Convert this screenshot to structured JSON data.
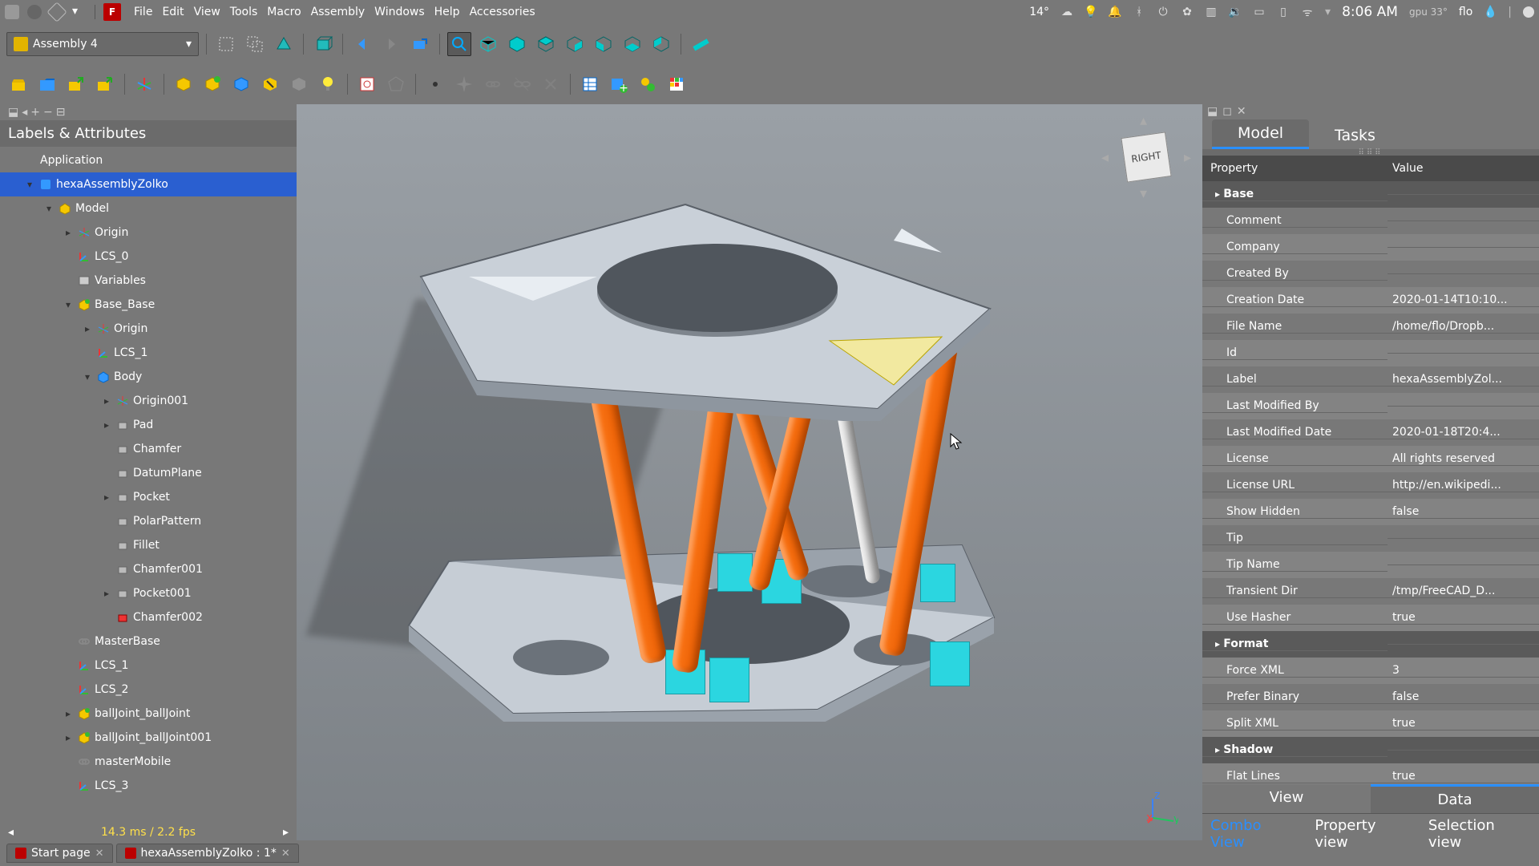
{
  "menubar": {
    "items": [
      "File",
      "Edit",
      "View",
      "Tools",
      "Macro",
      "Assembly",
      "Windows",
      "Help",
      "Accessories"
    ],
    "status": {
      "temp": "14°",
      "time": "8:06 AM",
      "gpu": "gpu 33°",
      "user": "flo"
    }
  },
  "workbench": {
    "selected": "Assembly 4"
  },
  "left_panel": {
    "title": "Labels & Attributes",
    "root": "Application"
  },
  "tree": [
    {
      "d": 0,
      "exp": "",
      "ico": "app",
      "label": "Application",
      "sel": false
    },
    {
      "d": 1,
      "exp": "▾",
      "ico": "doc",
      "label": "hexaAssemblyZolko",
      "sel": true
    },
    {
      "d": 2,
      "exp": "▾",
      "ico": "model",
      "label": "Model",
      "sel": false
    },
    {
      "d": 3,
      "exp": "▸",
      "ico": "origin",
      "label": "Origin",
      "sel": false
    },
    {
      "d": 3,
      "exp": "",
      "ico": "lcs",
      "label": "LCS_0",
      "sel": false
    },
    {
      "d": 3,
      "exp": "",
      "ico": "vars",
      "label": "Variables",
      "sel": false
    },
    {
      "d": 3,
      "exp": "▾",
      "ico": "body",
      "label": "Base_Base",
      "sel": false
    },
    {
      "d": 4,
      "exp": "▸",
      "ico": "origin",
      "label": "Origin",
      "sel": false
    },
    {
      "d": 4,
      "exp": "",
      "ico": "lcs",
      "label": "LCS_1",
      "sel": false
    },
    {
      "d": 4,
      "exp": "▾",
      "ico": "body2",
      "label": "Body",
      "sel": false
    },
    {
      "d": 5,
      "exp": "▸",
      "ico": "origin",
      "label": "Origin001",
      "sel": false
    },
    {
      "d": 5,
      "exp": "▸",
      "ico": "feat",
      "label": "Pad",
      "sel": false
    },
    {
      "d": 5,
      "exp": "",
      "ico": "feat",
      "label": "Chamfer",
      "sel": false
    },
    {
      "d": 5,
      "exp": "",
      "ico": "feat",
      "label": "DatumPlane",
      "sel": false
    },
    {
      "d": 5,
      "exp": "▸",
      "ico": "feat",
      "label": "Pocket",
      "sel": false
    },
    {
      "d": 5,
      "exp": "",
      "ico": "feat",
      "label": "PolarPattern",
      "sel": false
    },
    {
      "d": 5,
      "exp": "",
      "ico": "feat",
      "label": "Fillet",
      "sel": false
    },
    {
      "d": 5,
      "exp": "",
      "ico": "feat",
      "label": "Chamfer001",
      "sel": false
    },
    {
      "d": 5,
      "exp": "▸",
      "ico": "feat",
      "label": "Pocket001",
      "sel": false
    },
    {
      "d": 5,
      "exp": "",
      "ico": "feat2",
      "label": "Chamfer002",
      "sel": false
    },
    {
      "d": 3,
      "exp": "",
      "ico": "link",
      "label": "MasterBase",
      "sel": false
    },
    {
      "d": 3,
      "exp": "",
      "ico": "lcs",
      "label": "LCS_1",
      "sel": false
    },
    {
      "d": 3,
      "exp": "",
      "ico": "lcs",
      "label": "LCS_2",
      "sel": false
    },
    {
      "d": 3,
      "exp": "▸",
      "ico": "body",
      "label": "ballJoint_ballJoint",
      "sel": false
    },
    {
      "d": 3,
      "exp": "▸",
      "ico": "body",
      "label": "ballJoint_ballJoint001",
      "sel": false
    },
    {
      "d": 3,
      "exp": "",
      "ico": "link",
      "label": "masterMobile",
      "sel": false
    },
    {
      "d": 3,
      "exp": "",
      "ico": "lcs",
      "label": "LCS_3",
      "sel": false
    }
  ],
  "tree_footer": "14.3 ms / 2.2 fps",
  "navcube_face": "RIGHT",
  "right_panel": {
    "tabs": [
      "Model",
      "Tasks"
    ],
    "active_tab": 0,
    "headers": [
      "Property",
      "Value"
    ],
    "groups": [
      {
        "name": "Base",
        "rows": [
          {
            "p": "Comment",
            "v": ""
          },
          {
            "p": "Company",
            "v": ""
          },
          {
            "p": "Created By",
            "v": ""
          },
          {
            "p": "Creation Date",
            "v": "2020-01-14T10:10..."
          },
          {
            "p": "File Name",
            "v": "/home/flo/Dropb..."
          },
          {
            "p": "Id",
            "v": ""
          },
          {
            "p": "Label",
            "v": "hexaAssemblyZol..."
          },
          {
            "p": "Last Modified By",
            "v": ""
          },
          {
            "p": "Last Modified Date",
            "v": "2020-01-18T20:4..."
          },
          {
            "p": "License",
            "v": "All rights reserved"
          },
          {
            "p": "License URL",
            "v": "http://en.wikipedi..."
          },
          {
            "p": "Show Hidden",
            "v": "false"
          },
          {
            "p": "Tip",
            "v": ""
          },
          {
            "p": "Tip Name",
            "v": ""
          },
          {
            "p": "Transient Dir",
            "v": "/tmp/FreeCAD_D..."
          },
          {
            "p": "Use Hasher",
            "v": "true"
          }
        ]
      },
      {
        "name": "Format",
        "rows": [
          {
            "p": "Force XML",
            "v": "3"
          },
          {
            "p": "Prefer Binary",
            "v": "false"
          },
          {
            "p": "Split XML",
            "v": "true"
          }
        ]
      },
      {
        "name": "Shadow",
        "rows": [
          {
            "p": "Flat Lines",
            "v": "true"
          }
        ]
      }
    ],
    "bottom_tabs": [
      "View",
      "Data"
    ],
    "bottom_active": 1,
    "bottom_tabs2": [
      "Combo View",
      "Property view",
      "Selection view"
    ],
    "bottom2_active": 0
  },
  "doc_tabs": [
    {
      "label": "Start page",
      "modified": false
    },
    {
      "label": "hexaAssemblyZolko : 1*",
      "modified": true
    }
  ]
}
